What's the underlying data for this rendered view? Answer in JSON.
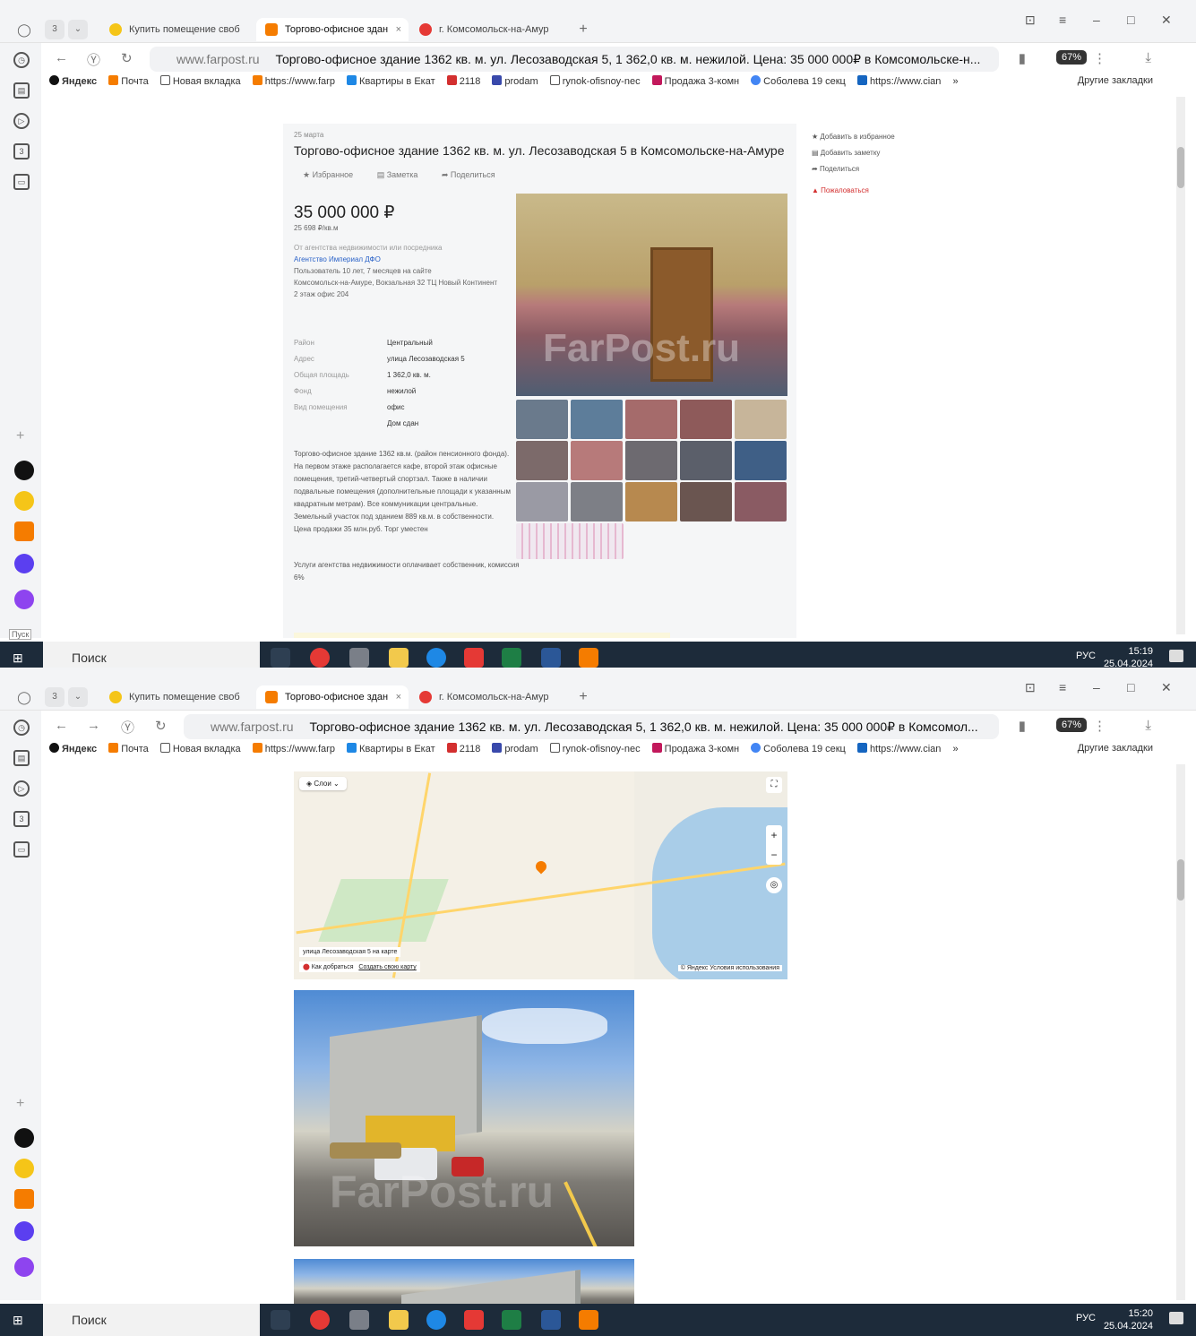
{
  "browser": {
    "tabs": [
      {
        "label": "Купить помещение своб",
        "active": false
      },
      {
        "label": "Торгово-офисное здан",
        "active": true
      },
      {
        "label": "г. Комсомольск-на-Амур",
        "active": false
      }
    ],
    "tab_counter": "3",
    "tab_close": "×",
    "new_tab": "+",
    "domain": "www.farpost.ru",
    "page_title_top": "Торгово-офисное здание 1362 кв. м. ул. Лесозаводская 5, 1 362,0 кв. м. нежилой. Цена: 35 000 000₽ в Комсомольске-н...",
    "page_title_bottom": "Торгово-офисное здание 1362 кв. м. ул. Лесозаводская 5, 1 362,0 кв. м. нежилой. Цена: 35 000 000₽ в Комсомол...",
    "zoom": "67%",
    "bookmarks": [
      "Яндекс",
      "Почта",
      "Новая вкладка",
      "https://www.farp",
      "Квартиры в Екат",
      "2118",
      "prodam",
      "rynok-ofisnoy-nec",
      "Продажа 3-комн",
      "Соболева 19 секц",
      "https://www.cian"
    ],
    "bookmarks_more": "»",
    "other_bookmarks": "Другие закладки"
  },
  "listing": {
    "date": "25 марта",
    "title": "Торгово-офисное здание 1362 кв. м. ул. Лесозаводская 5 в Комсомольске-на-Амуре",
    "actions": [
      "Избранное",
      "Заметка",
      "Поделиться"
    ],
    "price": "35 000 000 ₽",
    "price_per_m2": "25 698 ₽/кв.м",
    "seller_type": "От агентства недвижимости или посредника",
    "agency": "Агентство Империал ДФО",
    "agency_info": "Пользователь 10 лет, 7 месяцев на сайте",
    "agency_address": "Комсомольск-на-Амуре, Вокзальная 32 ТЦ Новый Континент 2 этаж офис 204",
    "props": [
      {
        "key": "Район",
        "value": "Центральный"
      },
      {
        "key": "Адрес",
        "value": "улица Лесозаводская 5"
      },
      {
        "key": "Общая площадь",
        "value": "1 362,0 кв. м."
      },
      {
        "key": "Фонд",
        "value": "нежилой"
      },
      {
        "key": "Вид помещения",
        "value": "офис"
      },
      {
        "key": "",
        "value": "Дом сдан"
      }
    ],
    "description": "Торгово-офисное здание 1362 кв.м. (район пенсионного фонда). На первом этаже располагается кафе, второй этаж офисные помещения, третий-четвертый спортзал. Также в наличии подвальные помещения (дополнительные площади к указанным квадратным метрам). Все коммуникации центральные. Земельный участок под зданием 889 кв.м. в собственности. Цена продажи 35 млн.руб. Торг уместен",
    "commission": "Услуги агентства недвижимости оплачивает собственник, комиссия 6%",
    "watermark": "FarPost.ru"
  },
  "side_menu": [
    "Добавить в избранное",
    "Добавить заметку",
    "Поделиться"
  ],
  "report": "Пожаловаться",
  "map": {
    "layers": "Слои",
    "address_label": "улица Лесозаводская 5 на карте",
    "route": "Как добраться",
    "own_map": "Создать свою карту",
    "terms": "© Яндекс Условия использования"
  },
  "taskbar": {
    "search": "Поиск",
    "lang": "РУС",
    "time_top": "15:19",
    "date_top": "25.04.2024",
    "time_bottom": "15:20",
    "date_bottom": "25.04.2024",
    "start_label": "Пуск"
  },
  "colors": {
    "link": "#2a62c8",
    "taskbar": "#1d2b3a",
    "accent": "#f57c00",
    "report": "#d32f2f"
  }
}
